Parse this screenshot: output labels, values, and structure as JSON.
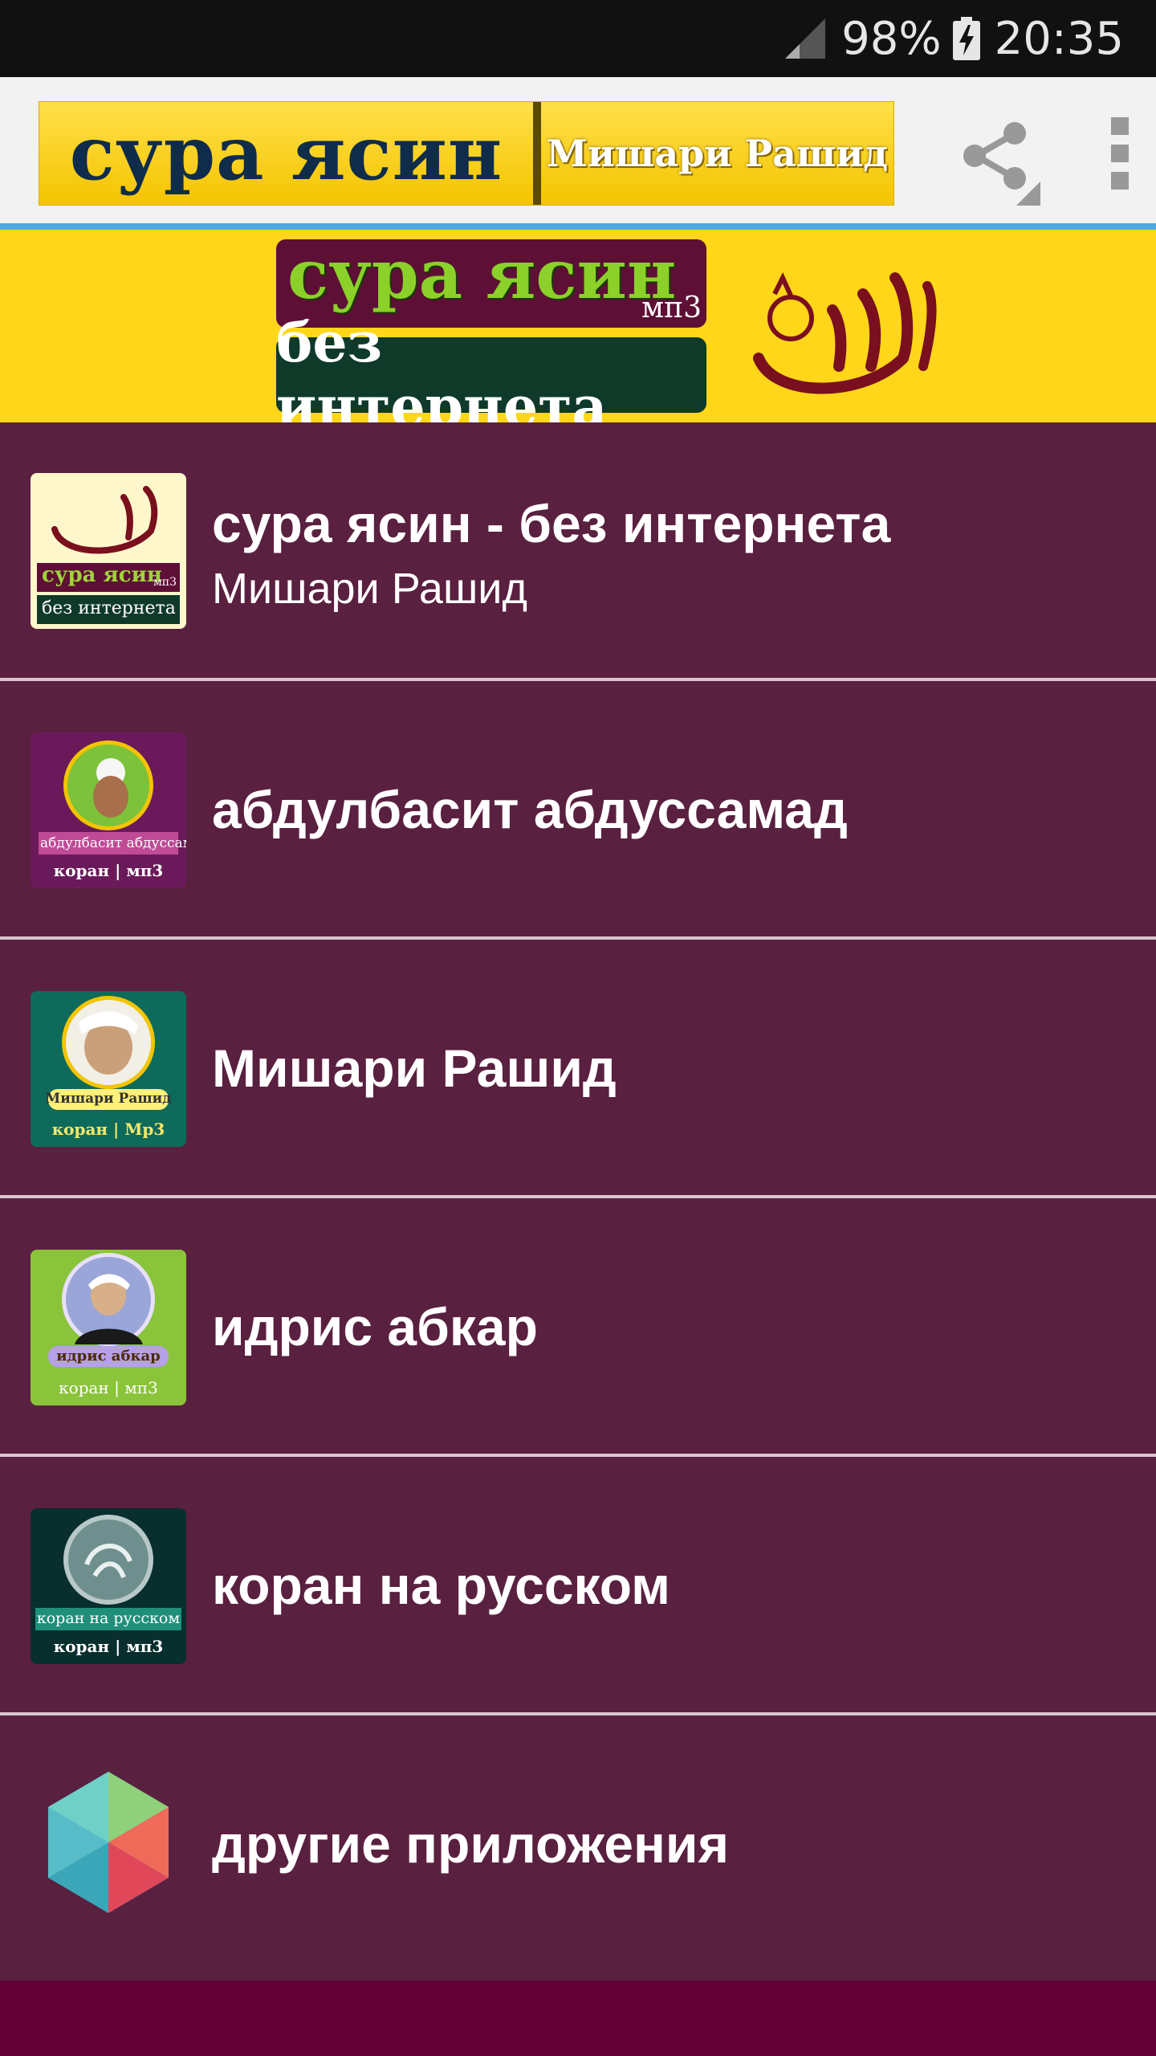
{
  "status_bar": {
    "battery_percent": "98%",
    "time": "20:35"
  },
  "app_bar": {
    "logo_title": "сура ясин",
    "logo_subtitle": "Мишари Рашид",
    "share_icon": "share-icon",
    "menu_icon": "overflow-menu-icon"
  },
  "banner": {
    "top_text": "сура ясин",
    "top_small": "мп3",
    "bottom_text": "без интернета"
  },
  "items": [
    {
      "title": "сура ясин - без интернета",
      "subtitle": "Мишари Рашид",
      "thumb_top": "сура ясин",
      "thumb_small": "мп3",
      "thumb_bottom": "без интернета"
    },
    {
      "title": "абдулбасит абдуссамад",
      "thumb_name": "абдулбасит абдуссамад",
      "thumb_caption": "коран | мп3"
    },
    {
      "title": "Мишари Рашид",
      "thumb_name": "Мишари Рашид",
      "thumb_caption": "коран | Мр3"
    },
    {
      "title": "идрис абкар",
      "thumb_name": "идрис абкар",
      "thumb_caption": "коран | мп3"
    },
    {
      "title": "коран на русском",
      "thumb_name": "коран на русском",
      "thumb_caption": "коран | мп3"
    },
    {
      "title": "другие приложения"
    }
  ],
  "colors": {
    "list_bg": "#5a2040",
    "divider": "#d9c6d0",
    "banner_bg": "#ffd61a",
    "bottom_bar": "#640036"
  }
}
